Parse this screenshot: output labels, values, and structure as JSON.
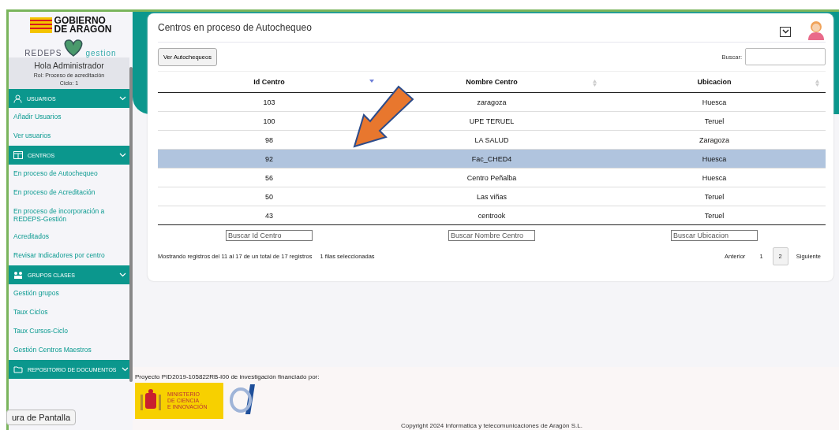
{
  "sidebar": {
    "logo_lines": [
      "GOBIERNO",
      "DE ARAGON"
    ],
    "brand": {
      "left": "REDEPS",
      "right": "gestion"
    },
    "user": {
      "greeting": "Hola Administrador",
      "role": "Rol: Proceso de acreditación",
      "cycle": "Ciclo: 1"
    },
    "sections": [
      {
        "title": "USUARIOS",
        "items": [
          "Añadir Usuarios",
          "Ver usuarios"
        ]
      },
      {
        "title": "CENTROS",
        "items": [
          "En proceso de Autochequeo",
          "En proceso de Acreditación",
          "En proceso de incorporación a REDEPS-Gestión",
          "Acreditados",
          "Revisar Indicadores por centro"
        ]
      },
      {
        "title": "GRUPOS CLASES",
        "items": [
          "Gestión grupos",
          "Taux Ciclos",
          "Taux Cursos-Ciclo",
          "Gestión Centros Maestros"
        ]
      },
      {
        "title": "REPOSITORIO DE DOCUMENTOS"
      }
    ]
  },
  "tooltip": "ura de Pantalla",
  "main": {
    "title": "Centros en proceso de Autochequeo",
    "button": "Ver Autochequeos",
    "search_label": "Buscar:",
    "columns": [
      {
        "label": "Id Centro",
        "sorted": true
      },
      {
        "label": "Nombre Centro",
        "sorted": false
      },
      {
        "label": "Ubicacion",
        "sorted": false
      }
    ],
    "rows": [
      {
        "cells": [
          "103",
          "zaragoza",
          "Huesca"
        ],
        "selected": false
      },
      {
        "cells": [
          "100",
          "UPE TERUEL",
          "Teruel"
        ],
        "selected": false
      },
      {
        "cells": [
          "98",
          "LA SALUD",
          "Zaragoza"
        ],
        "selected": false
      },
      {
        "cells": [
          "92",
          "Fac_CHED4",
          "Huesca"
        ],
        "selected": true
      },
      {
        "cells": [
          "56",
          "Centro Peñalba",
          "Huesca"
        ],
        "selected": false
      },
      {
        "cells": [
          "50",
          "Las viñas",
          "Teruel"
        ],
        "selected": false
      },
      {
        "cells": [
          "43",
          "centrook",
          "Teruel"
        ],
        "selected": false
      }
    ],
    "filters": [
      {
        "placeholder": "Buscar Id Centro"
      },
      {
        "placeholder": "Buscar Nombre Centro"
      },
      {
        "placeholder": "Buscar Ubicacion"
      }
    ],
    "info": "Mostrando registros del 11 al 17 de un total de 17 registros",
    "selection_info": "1 filas seleccionadas",
    "pagination": {
      "previous": "Anterior",
      "pages": [
        {
          "label": "1",
          "selected": false
        },
        {
          "label": "2",
          "selected": true
        }
      ],
      "next": "Siguiente"
    }
  },
  "footer": {
    "funding": "Proyecto PID2019-105822RB-I00 de investigación financiado por:",
    "ministry_lines": [
      "MINISTERIO",
      "DE CIENCIA",
      "E INNOVACIÓN"
    ],
    "copyright": "Copyright 2024 Informatica y telecomunicaciones de Aragón S.L."
  }
}
